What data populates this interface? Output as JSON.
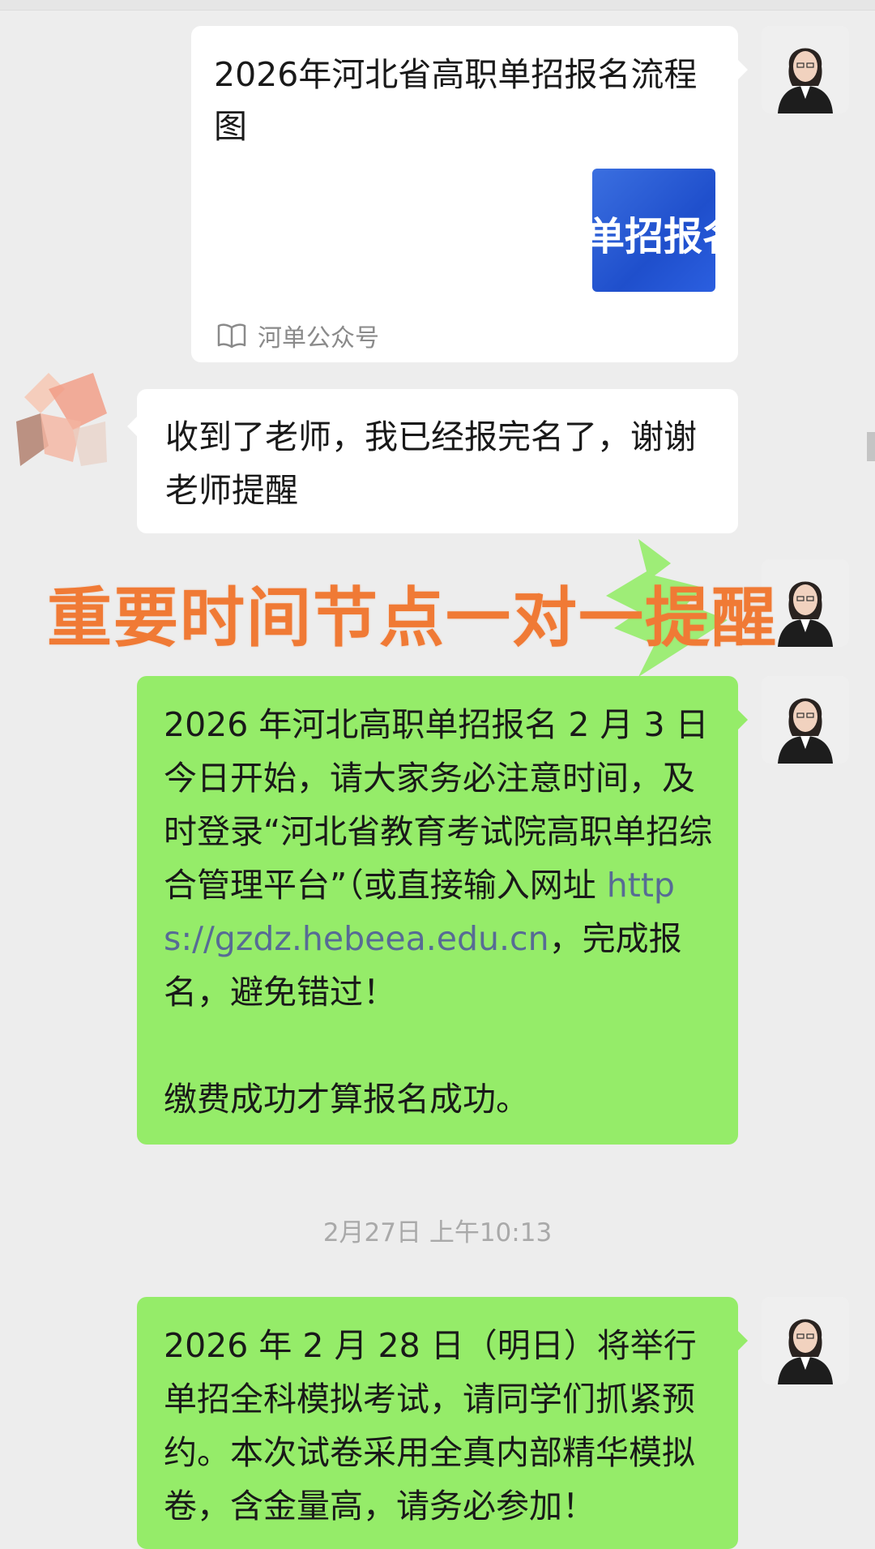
{
  "card": {
    "title": "2026年河北省高职单招报名流程图",
    "thumb_text": "单招报名",
    "source": "河单公众号",
    "source_icon": "book-open-icon"
  },
  "messages": [
    {
      "from": "student",
      "text": "收到了老师，我已经报完名了，谢谢老师提醒"
    },
    {
      "from": "teacher",
      "text_before": "2026 年河北高职单招报名 2 月 3 日今日开始，请大家务必注意时间，及时登录“河北省教育考试院高职单招综合管理平台”（或直接输入网址 ",
      "link": "https://gzdz.hebeea.edu.cn",
      "text_after": "，完成报名，避免错过！\n\n缴费成功才算报名成功。"
    },
    {
      "from": "teacher",
      "text": "2026 年 2 月 28 日（明日）将举行单招全科模拟考试，请同学们抓紧预约。本次试卷采用全真内部精华模拟卷，含金量高，请务必参加！"
    }
  ],
  "overlay_text": "重要时间节点一对一提醒",
  "timestamp": "2月27日 上午10:13",
  "colors": {
    "background": "#ededed",
    "bubble_white": "#ffffff",
    "bubble_green": "#95ec69",
    "link": "#576b95",
    "overlay": "#f07a35"
  }
}
